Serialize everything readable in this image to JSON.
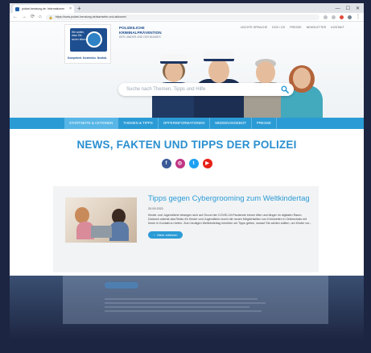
{
  "browser": {
    "tab_title": "polizei-beratung.de: Informationen",
    "url": "https://www.polizei-beratung.de/startseite-und-aktionen/",
    "close_glyph": "×",
    "new_tab_glyph": "+",
    "back_glyph": "←",
    "forward_glyph": "→",
    "reload_glyph": "⟳",
    "home_glyph": "⌂",
    "menu_glyph": "⋮",
    "window_controls": [
      "—",
      "☐",
      "✕"
    ],
    "extension_colors": [
      "#c0c4c8",
      "#c0c4c8",
      "#e34b3a",
      "#7a8794",
      "#c0c4c8"
    ]
  },
  "logo": {
    "mark_text": "Wir wollen, dass Sie sicher leben.",
    "tagline": "Kompetent. Kostenlos. Neutral."
  },
  "org": {
    "line1": "POLIZEILICHE",
    "line2": "KRIMINALPRÄVENTION",
    "sub": "DER LÄNDER UND DES BUNDES"
  },
  "topnav": [
    "LEICHTE SPRACHE",
    "DGS / GS",
    "PRESSE",
    "NEWSLETTER",
    "KONTAKT"
  ],
  "search": {
    "placeholder": "Suche nach Themen, Tipps und Hilfe"
  },
  "mainnav": {
    "items": [
      "STARTSEITE & AKTIONEN",
      "THEMEN & TIPPS",
      "OPFERINFORMATIONEN",
      "MEDIENANGEBOT",
      "PRESSE"
    ],
    "active_index": 0
  },
  "headline": "NEWS, FAKTEN UND TIPPS DER POLIZEI",
  "socials": [
    {
      "name": "facebook-icon",
      "glyph": "f",
      "color": "#3b5998"
    },
    {
      "name": "instagram-icon",
      "glyph": "◎",
      "color": "#c13584"
    },
    {
      "name": "twitter-icon",
      "glyph": "t",
      "color": "#1da1f2"
    },
    {
      "name": "youtube-icon",
      "glyph": "▶",
      "color": "#e62117"
    }
  ],
  "article": {
    "title": "Tipps gegen Cybergrooming zum Weltkindertag",
    "date": "20.09.2021",
    "body": "Kinder und Jugendliche bewegen sich auf Grund der COVID-19-Pandemie immer öfter und länger im digitalen Raum. Dadurch wächst das Risiko für Kinder und Jugendliche durch die neuen Möglichkeiten von Kriminellen in Onlinechats mit Ihnen in Kontakt zu treten. Zum heutigen Weltkindertag möchten wir Tipps geben, worauf Sie achten sollten, um Kinder vor...",
    "button_label": "Mehr erfahren",
    "button_glyph": "›"
  },
  "colors": {
    "accent": "#2b9bd6",
    "brand_dark": "#1d4e8f",
    "card_bg": "#f1f3f5"
  }
}
